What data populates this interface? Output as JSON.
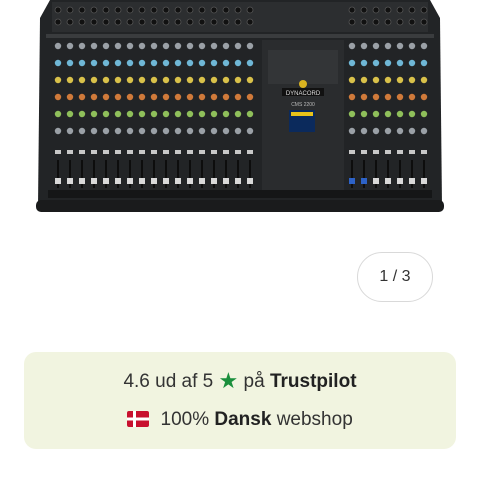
{
  "gallery": {
    "image_alt": "Dynacord CMS 2200 mixer",
    "counter_text": "1 / 3",
    "mixer_brand_text": "DYNACORD",
    "mixer_model_text": "CMS 2200"
  },
  "trust": {
    "rating_prefix": "4.6 ud af 5",
    "rating_suffix": "på",
    "trustpilot_label": "Trustpilot",
    "shop_percent": "100%",
    "shop_bold": "Dansk",
    "shop_suffix": "webshop"
  },
  "colors": {
    "trust_bg": "#f1f4e0",
    "star_green": "#1a8f3c",
    "flag_red": "#c8102e"
  },
  "icons": [
    "star-icon",
    "danish-flag-icon"
  ]
}
